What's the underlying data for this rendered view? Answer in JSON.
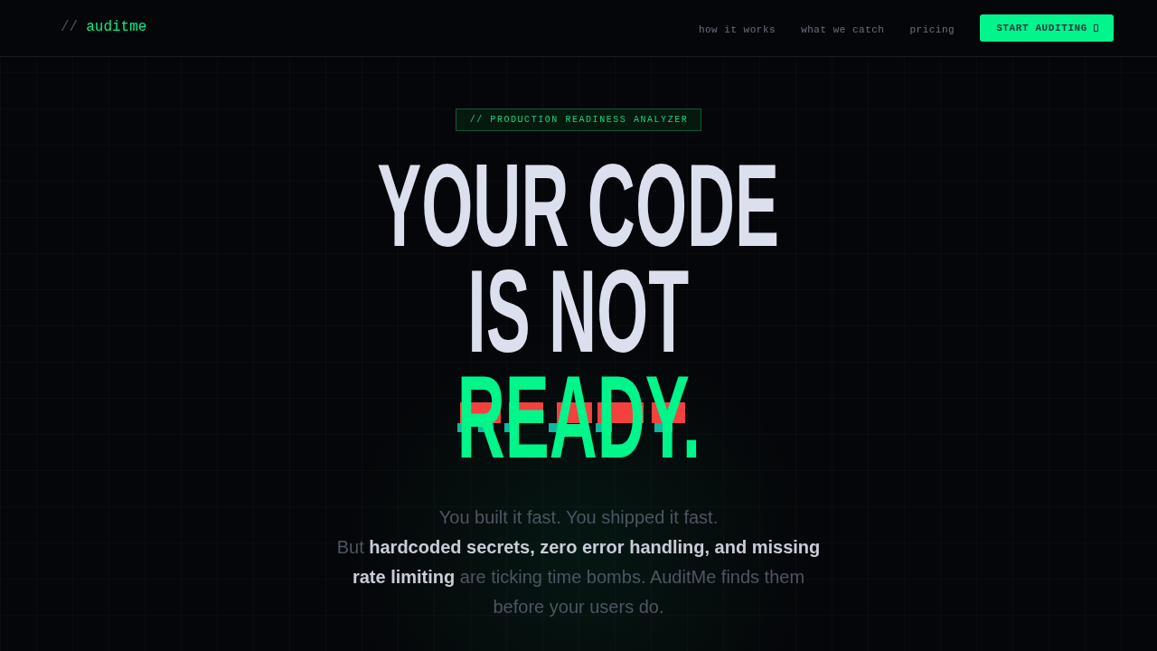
{
  "nav": {
    "logo": {
      "prefix": "//",
      "name": "auditme"
    },
    "links": [
      "how it works",
      "what we catch",
      "pricing"
    ],
    "cta": "START AUDITING"
  },
  "hero": {
    "badge": "// PRODUCTION READINESS ANALYZER",
    "headline": [
      {
        "text": "YOUR CODE",
        "kind": "plain"
      },
      {
        "text": "IS NOT",
        "kind": "plain"
      },
      {
        "text": "READY.",
        "kind": "glitch"
      }
    ],
    "subtitle": [
      "You built it fast. You shipped it fast.",
      "But **hardcoded secrets, zero error handling, and missing rate limiting** are ticking time bombs. AuditMe finds them before your users do."
    ]
  }
}
